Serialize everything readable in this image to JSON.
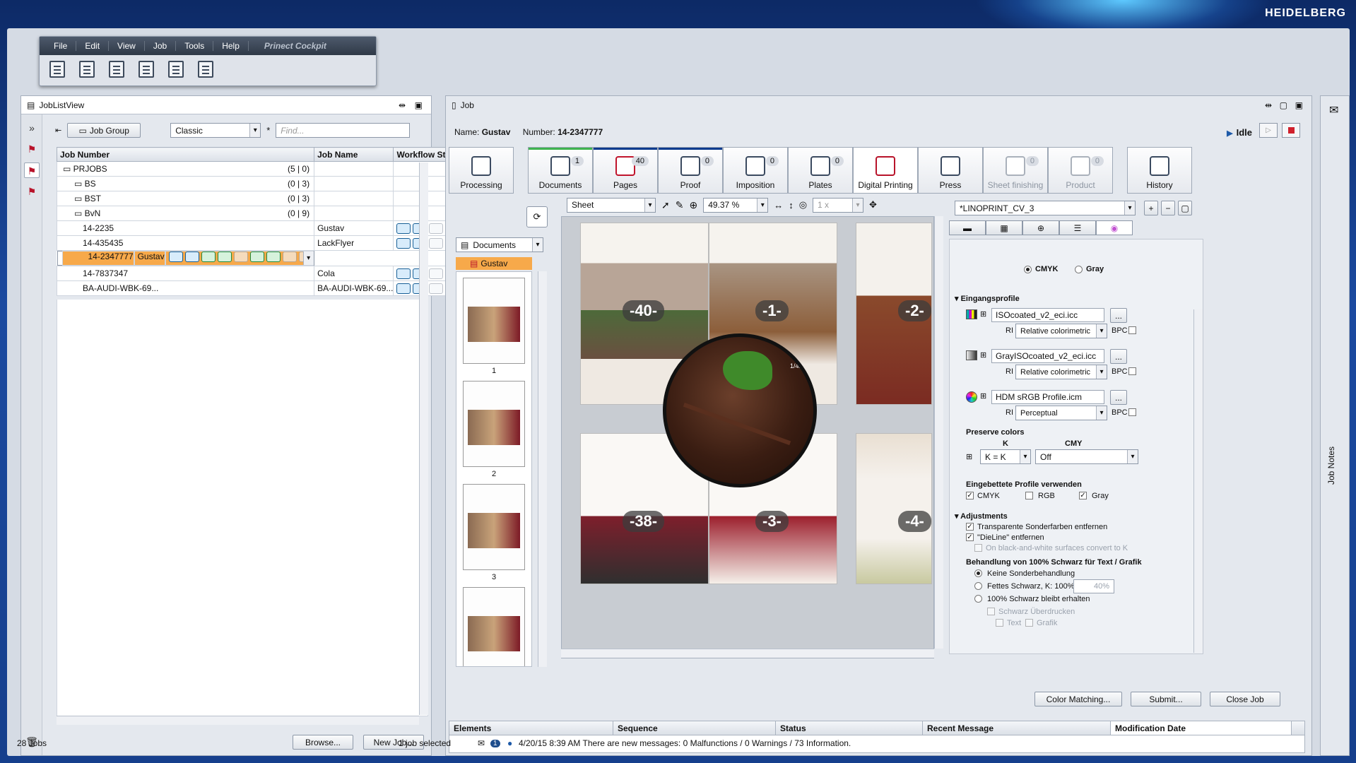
{
  "brand": "HEIDELBERG",
  "menu": {
    "items": [
      "File",
      "Edit",
      "View",
      "Job",
      "Tools",
      "Help"
    ],
    "app_name": "Prinect Cockpit"
  },
  "joblist": {
    "title": "JobListView",
    "group_button": "Job Group",
    "view_select": "Classic",
    "find_placeholder": "Find...",
    "columns": [
      "Job Number",
      "Job Name",
      "Workflow Status"
    ],
    "rows": [
      {
        "number": "PRJOBS",
        "name": "",
        "count": "(5 | 0)",
        "level": 0
      },
      {
        "number": "BS",
        "name": "",
        "count": "(0 | 3)",
        "level": 1
      },
      {
        "number": "BST",
        "name": "",
        "count": "(0 | 3)",
        "level": 1
      },
      {
        "number": "BvN",
        "name": "",
        "count": "(0 | 9)",
        "level": 1
      },
      {
        "number": "14-2235",
        "name": "Gustav",
        "count": "",
        "level": 2
      },
      {
        "number": "14-435435",
        "name": "LackFlyer",
        "count": "",
        "level": 2
      },
      {
        "number": "14-2347777",
        "name": "Gustav",
        "count": "",
        "level": 2
      },
      {
        "number": "14-7837347",
        "name": "Cola",
        "count": "",
        "level": 2
      },
      {
        "number": "BA-AUDI-WBK-69...",
        "name": "BA-AUDI-WBK-69...",
        "count": "",
        "level": 2
      }
    ],
    "browse_button": "Browse...",
    "newjob_button": "New Job..."
  },
  "job": {
    "title": "Job",
    "name_label": "Name:",
    "name_value": "Gustav",
    "number_label": "Number:",
    "number_value": "14-2347777",
    "state": "Idle",
    "ribbon": [
      {
        "label": "Processing",
        "count": ""
      },
      {
        "label": "Documents",
        "count": "1"
      },
      {
        "label": "Pages",
        "count": "40"
      },
      {
        "label": "Proof",
        "count": "0"
      },
      {
        "label": "Imposition",
        "count": "0"
      },
      {
        "label": "Plates",
        "count": "0"
      },
      {
        "label": "Digital Printing",
        "count": ""
      },
      {
        "label": "Press",
        "count": ""
      },
      {
        "label": "Sheet finishing",
        "count": "0"
      },
      {
        "label": "Product",
        "count": "0"
      },
      {
        "label": "History",
        "count": ""
      }
    ],
    "documents_select": "Documents",
    "tree_item": "Gustav",
    "thumb_numbers": [
      "1",
      "2",
      "3"
    ],
    "viewer": {
      "mode": "Sheet",
      "zoom": "49.37 %",
      "copies": "1 x",
      "loupe_label": "1/4x",
      "page_badges": [
        "-40-",
        "-1-",
        "-2-",
        "-38-",
        "-3-",
        "-4-"
      ]
    },
    "bottom_columns": [
      "Elements",
      "Sequence",
      "Status",
      "Recent Message",
      "Modification Date"
    ],
    "buttons": {
      "color_matching": "Color Matching...",
      "submit": "Submit...",
      "close": "Close Job"
    }
  },
  "props": {
    "device": "*LINOPRINT_CV_3",
    "mode_cmyk": "CMYK",
    "mode_gray": "Gray",
    "input_profiles_title": "Eingangsprofile",
    "profiles": [
      {
        "name": "ISOcoated_v2_eci.icc",
        "ri": "Relative colorimetric"
      },
      {
        "name": "GrayISOcoated_v2_eci.icc",
        "ri": "Relative colorimetric"
      },
      {
        "name": "HDM sRGB Profile.icm",
        "ri": "Perceptual"
      }
    ],
    "ri_label": "RI",
    "bpc_label": "BPC",
    "preserve_title": "Preserve colors",
    "k_label": "K",
    "cmy_label": "CMY",
    "k_value": "K = K",
    "cmy_value": "Off",
    "embedded_title": "Eingebettete Profile verwenden",
    "embedded": [
      "CMYK",
      "RGB",
      "Gray"
    ],
    "adjust_title": "Adjustments",
    "adjust_items": [
      "Transparente Sonderfarben entfernen",
      "\"DieLine\" entfernen",
      "On black-and-white surfaces convert to K"
    ],
    "black_title": "Behandlung von 100% Schwarz für Text / Grafik",
    "black_options": [
      "Keine Sonderbehandlung",
      "Fettes Schwarz, K: 100% C:",
      "100% Schwarz bleibt erhalten"
    ],
    "black_c_value": "40%",
    "overprint": "Schwarz Überdrucken",
    "overprint_text": "Text",
    "overprint_grafik": "Grafik"
  },
  "jobnotes_label": "Job Notes",
  "status": {
    "jobs": "28 Jobs",
    "selected": "1 job selected",
    "message": "4/20/15 8:39 AM  There are new messages: 0 Malfunctions / 0 Warnings / 73 Information.",
    "msg_count": "1"
  }
}
